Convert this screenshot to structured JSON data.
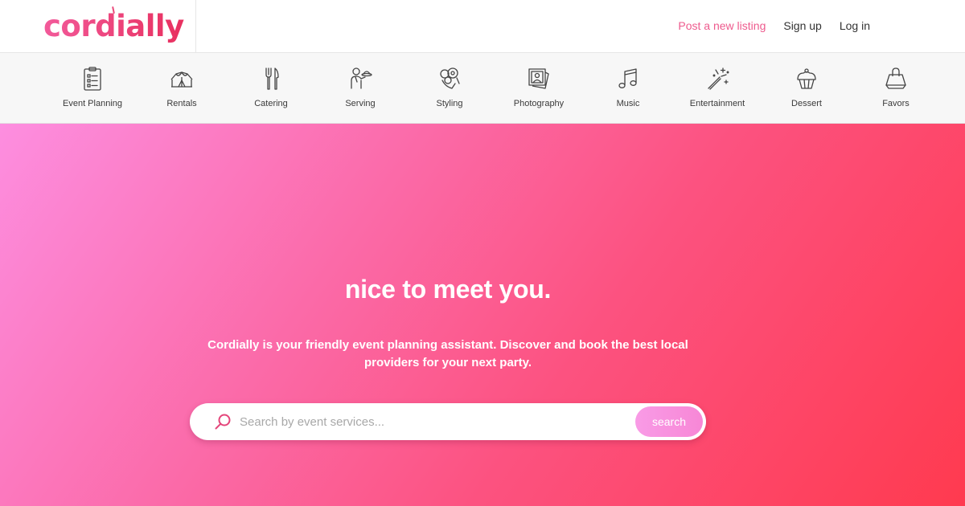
{
  "brand": {
    "name": "cordially",
    "color": "#e6336f"
  },
  "topnav": {
    "post_listing": "Post a new listing",
    "sign_up": "Sign up",
    "log_in": "Log in",
    "accent_color": "#ee5a8d"
  },
  "categories": [
    {
      "label": "Event Planning",
      "icon": "clipboard-checklist-icon"
    },
    {
      "label": "Rentals",
      "icon": "tent-icon"
    },
    {
      "label": "Catering",
      "icon": "fork-knife-icon"
    },
    {
      "label": "Serving",
      "icon": "waiter-tray-icon"
    },
    {
      "label": "Styling",
      "icon": "flower-bouquet-icon"
    },
    {
      "label": "Photography",
      "icon": "photo-stack-icon"
    },
    {
      "label": "Music",
      "icon": "music-note-icon"
    },
    {
      "label": "Entertainment",
      "icon": "magic-wand-icon"
    },
    {
      "label": "Dessert",
      "icon": "cupcake-icon"
    },
    {
      "label": "Favors",
      "icon": "gift-bag-icon"
    }
  ],
  "hero": {
    "headline": "nice to meet you.",
    "subtext": "Cordially is your friendly event planning assistant. Discover and book the best local providers for your next party.",
    "gradient": [
      "#fd8ee0",
      "#ff3a4f"
    ]
  },
  "search": {
    "placeholder": "Search by event services...",
    "value": "",
    "button_label": "search",
    "button_color": "#f99be6"
  }
}
